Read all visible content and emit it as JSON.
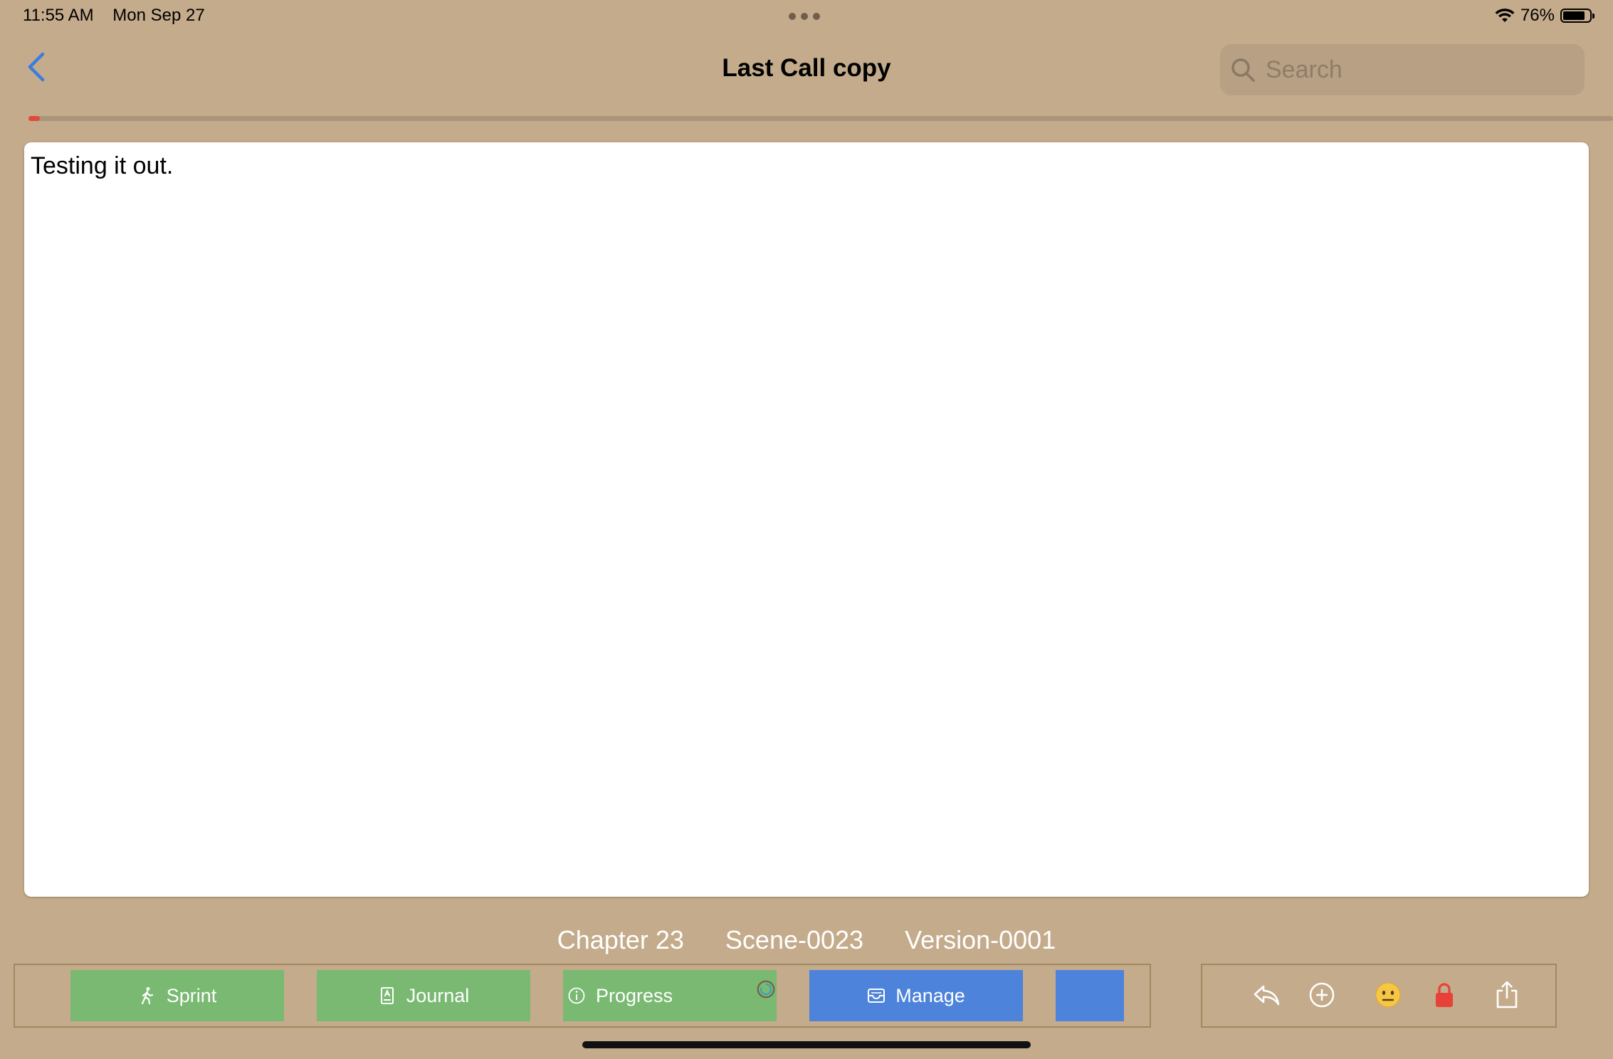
{
  "status_bar": {
    "time": "11:55 AM",
    "date": "Mon Sep 27",
    "battery_text": "76%",
    "battery_level": 0.76,
    "wifi_icon": "wifi-icon"
  },
  "nav": {
    "title": "Last Call copy",
    "back_icon": "chevron-left-icon",
    "search_placeholder": "Search"
  },
  "progress": {
    "fraction": 0.007,
    "color": "#e04a3a"
  },
  "editor": {
    "text": "Testing it out."
  },
  "meta": {
    "chapter": "Chapter 23",
    "scene": "Scene-0023",
    "version": "Version-0001"
  },
  "toolbar": {
    "buttons": [
      {
        "label": "Sprint",
        "icon": "figure-walk-icon",
        "color": "#79b972"
      },
      {
        "label": "Journal",
        "icon": "journal-icon",
        "color": "#79b972"
      },
      {
        "label": "Progress",
        "icon": "info-icon",
        "color": "#79b972"
      },
      {
        "label": "Manage",
        "icon": "tray-icon",
        "color": "#4d83da"
      },
      {
        "label": "",
        "icon": "",
        "color": "#4d83da"
      }
    ],
    "actions": [
      "reply-icon",
      "plus-circle-icon",
      "neutral-face-icon",
      "lock-icon",
      "share-icon"
    ]
  },
  "colors": {
    "background": "#c4ab8b",
    "accent_blue": "#3b7de0",
    "lock_red": "#e8413a"
  }
}
